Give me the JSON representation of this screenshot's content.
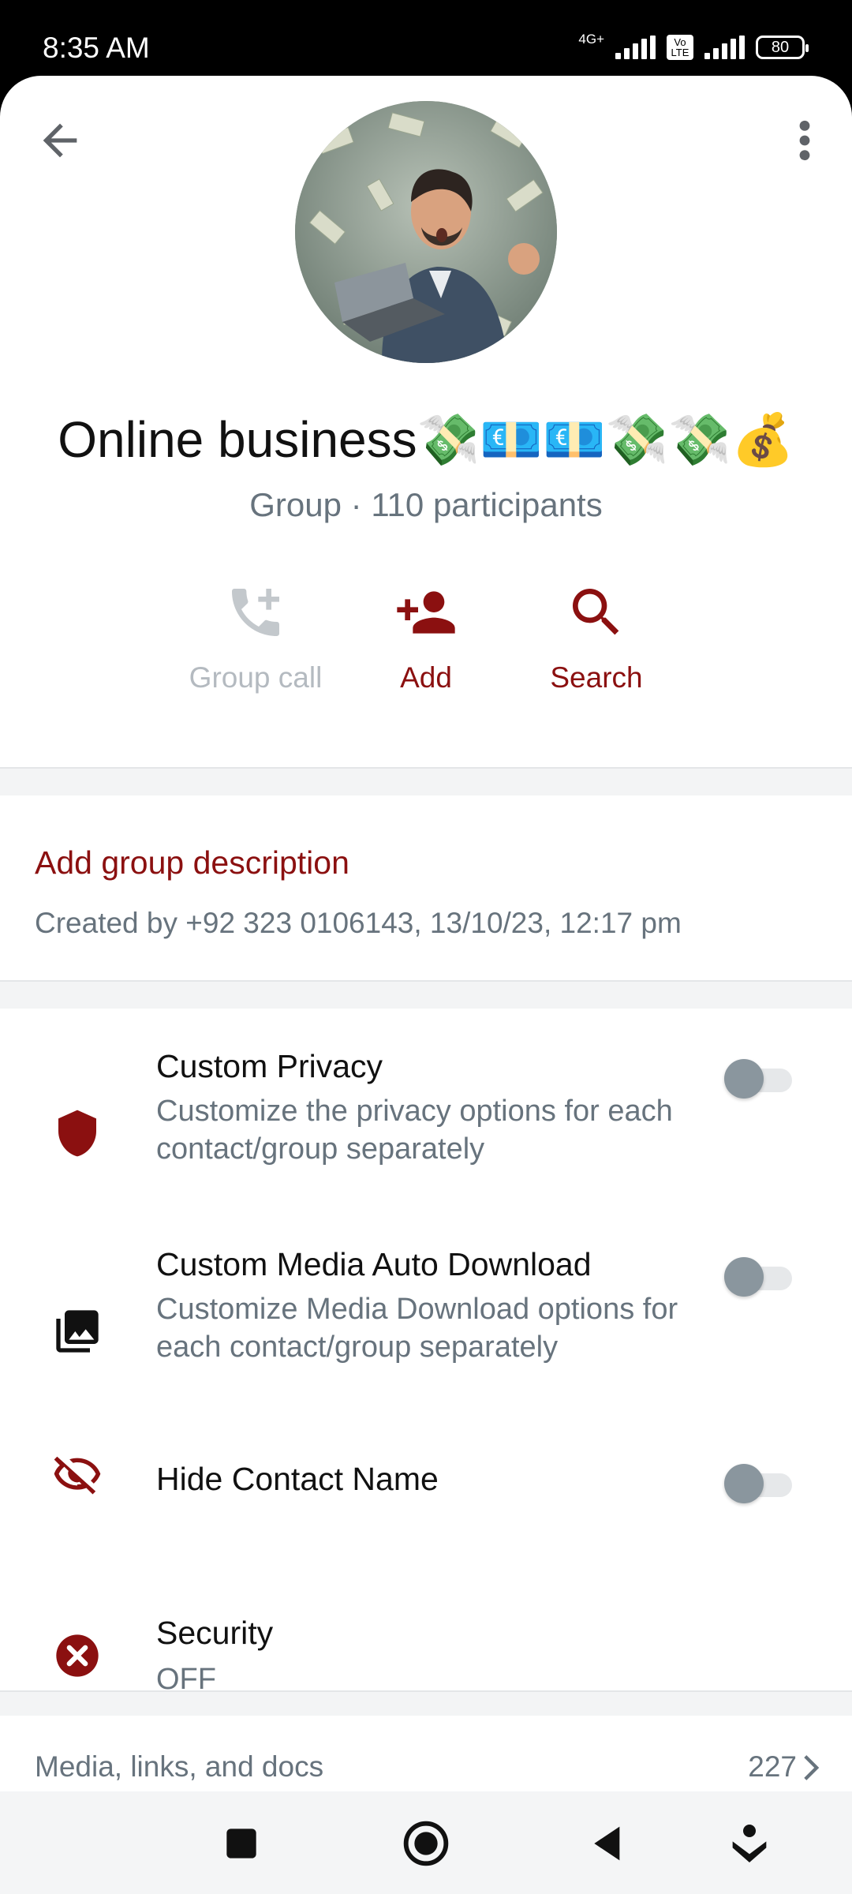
{
  "status_bar": {
    "time": "8:35 AM",
    "network": "4G+",
    "volte": "Vo LTE",
    "battery": "80"
  },
  "header": {
    "back_icon": "arrow-left-icon",
    "more_icon": "more-vert-icon"
  },
  "group": {
    "name": "Online business💸💶💶💸💸💰",
    "subtitle": "Group · 110 participants"
  },
  "actions": [
    {
      "label": "Group call",
      "icon": "add-call-icon",
      "enabled": false
    },
    {
      "label": "Add",
      "icon": "person-add-icon",
      "enabled": true
    },
    {
      "label": "Search",
      "icon": "search-icon",
      "enabled": true
    }
  ],
  "description": {
    "title": "Add group description",
    "created": "Created by +92 323 0106143, 13/10/23, 12:17 pm"
  },
  "settings": [
    {
      "title": "Custom Privacy",
      "desc": "Customize the privacy options for each contact/group separately",
      "icon": "shield-icon",
      "toggle": false
    },
    {
      "title": "Custom Media Auto Download",
      "desc": "Customize Media Download options for each contact/group separately",
      "icon": "photo-library-icon",
      "toggle": false
    },
    {
      "title": "Hide Contact Name",
      "desc": "",
      "icon": "eye-off-icon",
      "toggle": false
    },
    {
      "title": "Security",
      "desc": "OFF",
      "icon": "cancel-circle-icon"
    }
  ],
  "media": {
    "label": "Media, links, and docs",
    "count": "227"
  },
  "colors": {
    "accent": "#8b1010",
    "muted": "#67737d",
    "disabled": "#b4bac0"
  }
}
